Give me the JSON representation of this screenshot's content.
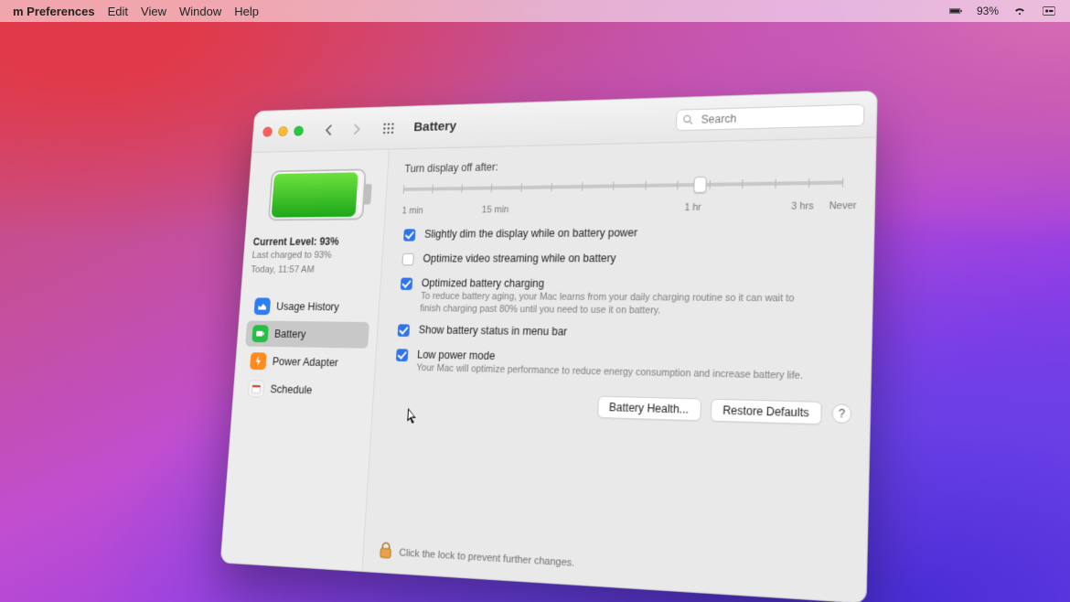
{
  "menubar": {
    "app_label": "m Preferences",
    "menus": [
      "Edit",
      "View",
      "Window",
      "Help"
    ],
    "battery_pct": "93%"
  },
  "window": {
    "title": "Battery",
    "search_placeholder": "Search"
  },
  "sidebar": {
    "level_label": "Current Level: 93%",
    "last_charged": "Last charged to 93%",
    "timestamp": "Today, 11:57 AM",
    "items": [
      {
        "label": "Usage History"
      },
      {
        "label": "Battery"
      },
      {
        "label": "Power Adapter"
      },
      {
        "label": "Schedule"
      }
    ]
  },
  "main": {
    "slider": {
      "label": "Turn display off after:",
      "tick_labels": {
        "l0": "1 min",
        "l1": "15 min",
        "l2": "1 hr",
        "l3": "3 hrs",
        "l4": "Never"
      },
      "value_percent": 66
    },
    "opts": [
      {
        "label": "Slightly dim the display while on battery power",
        "checked": true,
        "desc": ""
      },
      {
        "label": "Optimize video streaming while on battery",
        "checked": false,
        "desc": ""
      },
      {
        "label": "Optimized battery charging",
        "checked": true,
        "desc": "To reduce battery aging, your Mac learns from your daily charging routine so it can wait to finish charging past 80% until you need to use it on battery."
      },
      {
        "label": "Show battery status in menu bar",
        "checked": true,
        "desc": ""
      },
      {
        "label": "Low power mode",
        "checked": true,
        "desc": "Your Mac will optimize performance to reduce energy consumption and increase battery life."
      }
    ],
    "battery_health_btn": "Battery Health...",
    "restore_btn": "Restore Defaults",
    "help": "?",
    "lock_text": "Click the lock to prevent further changes."
  }
}
